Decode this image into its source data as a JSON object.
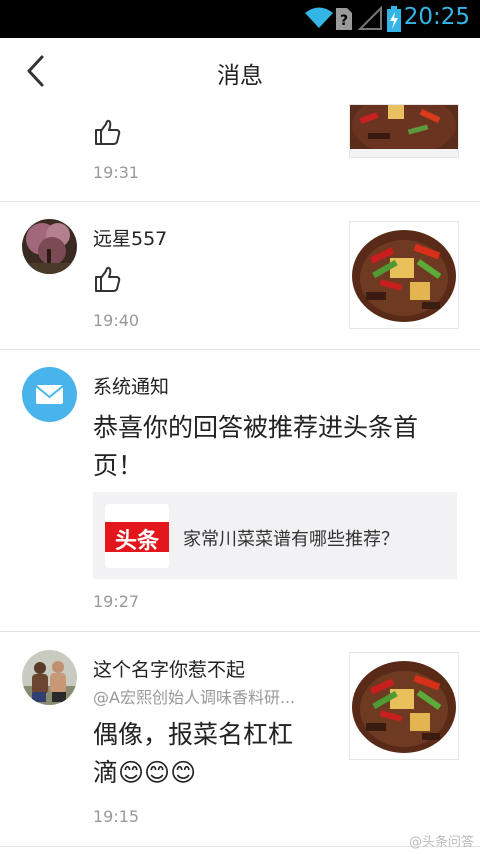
{
  "status_bar": {
    "time": "20:25"
  },
  "header": {
    "title": "消息"
  },
  "messages": [
    {
      "time": "19:31"
    },
    {
      "name": "远星557",
      "time": "19:40"
    },
    {
      "name": "系统通知",
      "text": "恭喜你的回答被推荐进头条首页！",
      "text_line1": "恭喜你的回答被推荐进头条首",
      "text_line2": "页！",
      "card": {
        "logo_text": "头条",
        "title": "家常川菜菜谱有哪些推荐？"
      },
      "time": "19:27"
    },
    {
      "name": "这个名字你惹不起",
      "mention": "@A宏熙创始人调味香料研...",
      "text_line1": "偶像，报菜名杠杠",
      "text_line2": "滴😊😊😊",
      "time": "19:15"
    }
  ],
  "watermark": "@头条问答",
  "colors": {
    "accent_blue": "#35b5e5",
    "system_icon": "#49b4ec",
    "brand_red": "#e3161b"
  }
}
